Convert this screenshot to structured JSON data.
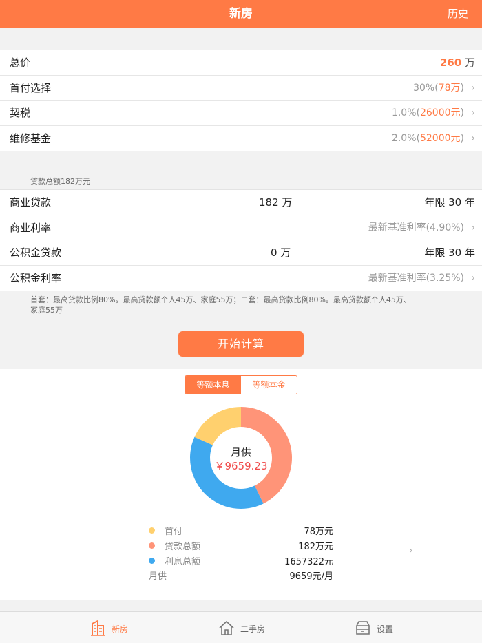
{
  "nav": {
    "title": "新房",
    "right_label": "历史"
  },
  "house": {
    "total_label": "总价",
    "total_value": "260",
    "total_unit": "万",
    "down_label": "首付选择",
    "down_pct": "30%",
    "down_amount": "78万",
    "deed_label": "契税",
    "deed_pct": "1.0%",
    "deed_amount": "26000元",
    "fund_label": "维修基金",
    "fund_pct": "2.0%",
    "fund_amount": "52000元"
  },
  "loan": {
    "total_note": "贷款总额182万元",
    "commercial_label": "商业贷款",
    "commercial_amount": "182 万",
    "commercial_term": "年限 30 年",
    "commercial_rate_label": "商业利率",
    "commercial_rate_value": "最新基准利率(4.90%)",
    "fund_label": "公积金贷款",
    "fund_amount": "0 万",
    "fund_term": "年限 30 年",
    "fund_rate_label": "公积金利率",
    "fund_rate_value": "最新基准利率(3.25%)",
    "policy_line1": "首套：最高贷款比例80%。最高贷款额个人45万、家庭55万；二套：最高贷款比例80%。最高贷款额个人45万、",
    "policy_line2": "家庭55万"
  },
  "calc_button": "开始计算",
  "result": {
    "mode_tabs": [
      "等额本息",
      "等额本金"
    ],
    "center_label": "月供",
    "center_value": "￥9659.23",
    "legend": [
      {
        "name": "首付",
        "value": "78万元",
        "color": "#ffd06e"
      },
      {
        "name": "贷款总额",
        "value": "182万元",
        "color": "#ff9478"
      },
      {
        "name": "利息总额",
        "value": "1657322元",
        "color": "#3fa9ef"
      }
    ],
    "monthly_label": "月供",
    "monthly_value": "9659元/月"
  },
  "chart_data": {
    "type": "pie",
    "categories": [
      "首付",
      "贷款总额",
      "利息总额"
    ],
    "values": [
      780000,
      1820000,
      1657322
    ],
    "colors": [
      "#ffd06e",
      "#ff9478",
      "#3fa9ef"
    ],
    "title": "月供"
  },
  "tabs": [
    {
      "label": "新房",
      "icon": "building-icon",
      "color": "#ff7a45"
    },
    {
      "label": "二手房",
      "icon": "house-icon",
      "color": "#666666"
    },
    {
      "label": "设置",
      "icon": "settings-box-icon",
      "color": "#666666"
    }
  ],
  "chevron": "›"
}
